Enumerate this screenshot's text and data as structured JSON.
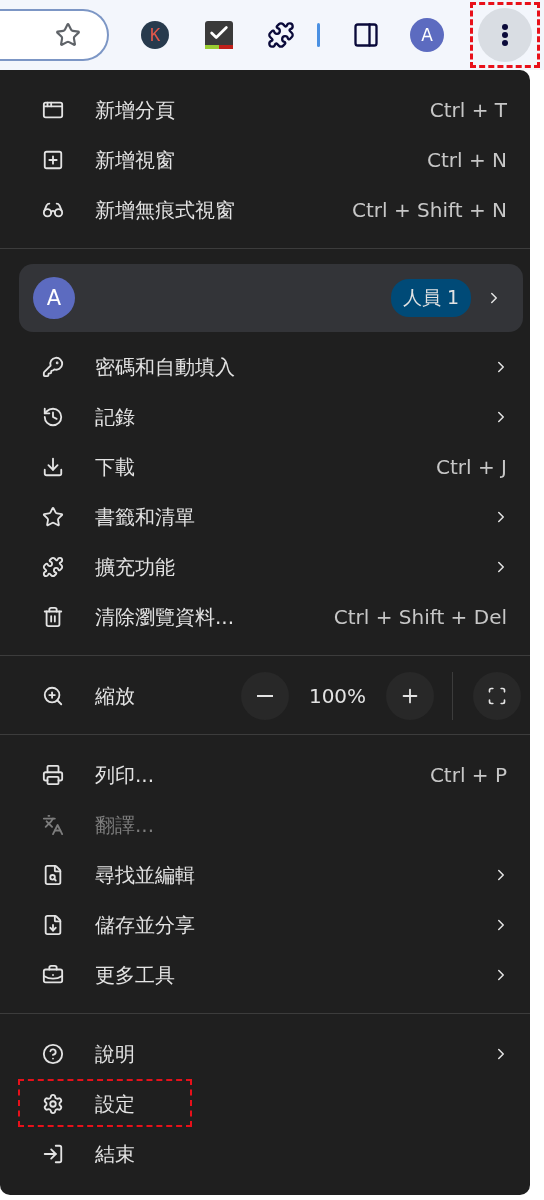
{
  "toolbar": {
    "extension_letter": "K",
    "avatar": "A",
    "menu_button_highlighted": true
  },
  "menu": {
    "sections": [
      {
        "items": [
          {
            "kind": "item",
            "label": "新增分頁",
            "shortcut": "Ctrl + T",
            "submenu": false,
            "disabled": false,
            "highlighted": false
          },
          {
            "kind": "item",
            "label": "新增視窗",
            "shortcut": "Ctrl + N",
            "submenu": false,
            "disabled": false,
            "highlighted": false
          },
          {
            "kind": "item",
            "label": "新增無痕式視窗",
            "shortcut": "Ctrl + Shift + N",
            "submenu": false,
            "disabled": false,
            "highlighted": false
          }
        ]
      },
      {
        "items": [
          {
            "kind": "profile",
            "avatar": "A",
            "label": "人員 1",
            "submenu": true
          },
          {
            "kind": "item",
            "label": "密碼和自動填入",
            "submenu": true,
            "disabled": false,
            "highlighted": false
          },
          {
            "kind": "item",
            "label": "記錄",
            "submenu": true,
            "disabled": false,
            "highlighted": false
          },
          {
            "kind": "item",
            "label": "下載",
            "shortcut": "Ctrl + J",
            "submenu": false,
            "disabled": false,
            "highlighted": false
          },
          {
            "kind": "item",
            "label": "書籤和清單",
            "submenu": true,
            "disabled": false,
            "highlighted": false
          },
          {
            "kind": "item",
            "label": "擴充功能",
            "submenu": true,
            "disabled": false,
            "highlighted": false
          },
          {
            "kind": "item",
            "label": "清除瀏覽資料...",
            "shortcut": "Ctrl + Shift + Del",
            "submenu": false,
            "disabled": false,
            "highlighted": false
          }
        ]
      },
      {
        "items": [
          {
            "kind": "zoom",
            "label": "縮放",
            "value": "100%"
          }
        ]
      },
      {
        "items": [
          {
            "kind": "item",
            "label": "列印...",
            "shortcut": "Ctrl + P",
            "submenu": false,
            "disabled": false,
            "highlighted": false
          },
          {
            "kind": "item",
            "label": "翻譯...",
            "submenu": false,
            "disabled": true,
            "highlighted": false
          },
          {
            "kind": "item",
            "label": "尋找並編輯",
            "submenu": true,
            "disabled": false,
            "highlighted": false
          },
          {
            "kind": "item",
            "label": "儲存並分享",
            "submenu": true,
            "disabled": false,
            "highlighted": false
          },
          {
            "kind": "item",
            "label": "更多工具",
            "submenu": true,
            "disabled": false,
            "highlighted": false
          }
        ]
      },
      {
        "items": [
          {
            "kind": "item",
            "label": "說明",
            "submenu": true,
            "disabled": false,
            "highlighted": false
          },
          {
            "kind": "item",
            "label": "設定",
            "submenu": false,
            "disabled": false,
            "highlighted": true
          },
          {
            "kind": "item",
            "label": "結束",
            "submenu": false,
            "disabled": false,
            "highlighted": false
          }
        ]
      }
    ]
  }
}
